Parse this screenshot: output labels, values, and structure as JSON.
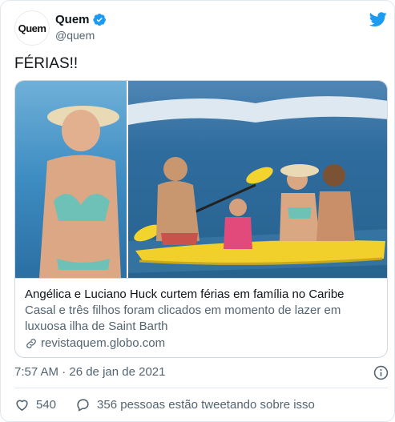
{
  "account": {
    "display_name": "Quem",
    "handle": "@quem",
    "avatar_text": "Quem",
    "verified_color": "#1d9bf0"
  },
  "tweet": {
    "text": "FÉRIAS!!",
    "timestamp": "7:57 AM · 26 de jan de 2021"
  },
  "card": {
    "title": "Angélica e Luciano Huck curtem férias em família no Caribe",
    "description": "Casal e três filhos foram clicados em momento de lazer em luxuosa ilha de Saint Barth",
    "domain": "revistaquem.globo.com"
  },
  "actions": {
    "likes": "540",
    "talking": "356 pessoas estão tweetando sobre isso"
  },
  "icons": {
    "brand": "twitter-bird-icon",
    "verified": "verified-badge-icon",
    "info": "info-icon",
    "like": "heart-icon",
    "reply": "comment-bubble-icon",
    "link": "link-icon"
  },
  "colors": {
    "brand_blue": "#1d9bf0",
    "text_primary": "#0f1419",
    "text_secondary": "#536471",
    "border": "#cfd9de"
  }
}
